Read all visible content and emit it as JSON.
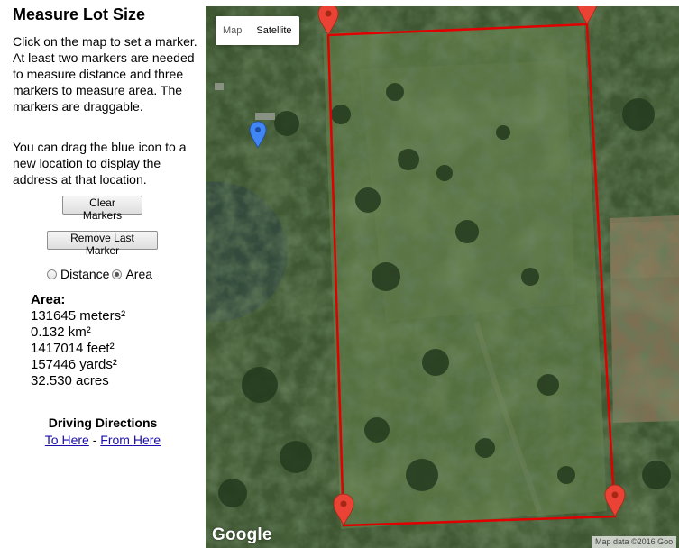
{
  "sidebar": {
    "title": "Measure Lot Size",
    "instructions": "Click on the map to set a marker. At least two markers are needed to measure distance and three markers to measure area. The markers are draggable.",
    "drag_hint": "You can drag the blue icon to a new location to display the address at that location.",
    "clear_label": "Clear Markers",
    "remove_label": "Remove Last Marker",
    "mode": {
      "distance_label": "Distance",
      "area_label": "Area",
      "selected": "Area"
    },
    "area": {
      "title": "Area:",
      "sq_meters": "131645 meters²",
      "sq_km": "0.132 km²",
      "sq_feet": "1417014 feet²",
      "sq_yards": "157446 yards²",
      "acres": "32.530 acres"
    },
    "directions": {
      "title": "Driving Directions",
      "to_here": "To Here",
      "separator": " - ",
      "from_here": "From Here"
    }
  },
  "map": {
    "type_map_label": "Map",
    "type_satellite_label": "Satellite",
    "selected_type": "Satellite",
    "logo": "Google",
    "attribution": "Map data ©2016 Goo",
    "polygon_color": "#e00000",
    "marker_color": "#ea4335",
    "blue_marker_color": "#4285f4"
  }
}
